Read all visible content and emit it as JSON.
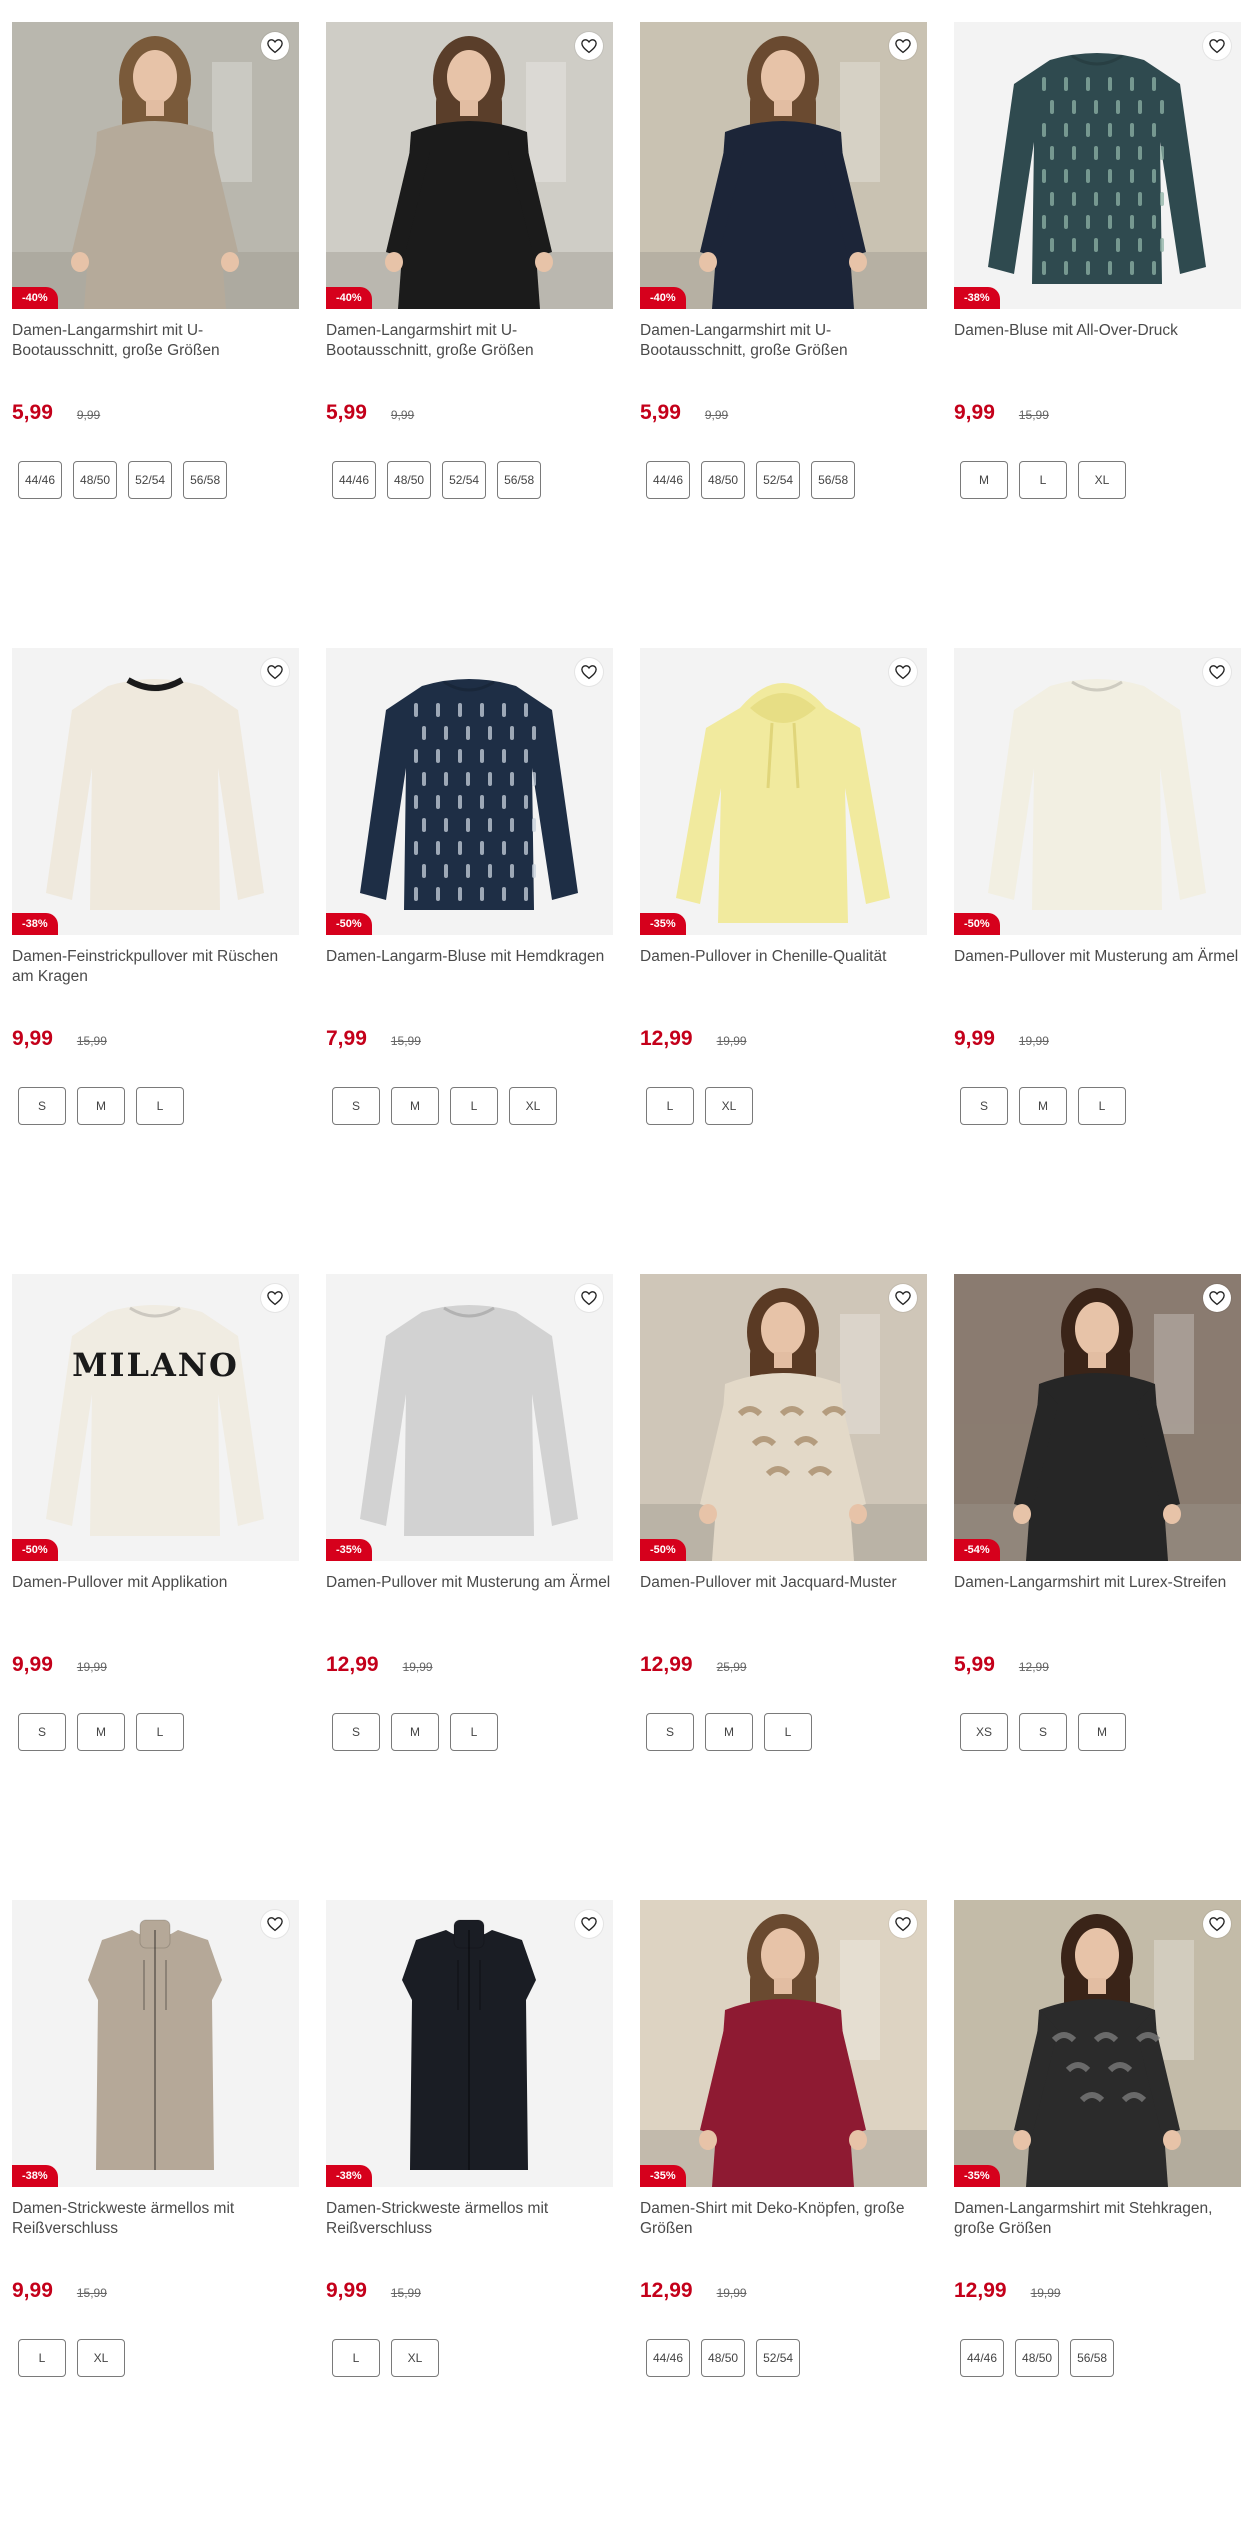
{
  "products": [
    {
      "title": "Damen-Langarmshirt mit U-Bootausschnitt, große Größen",
      "price": "5,99",
      "old_price": "9,99",
      "discount": "-40%",
      "sizes": [
        "44/46",
        "48/50",
        "52/54",
        "56/58"
      ]
    },
    {
      "title": "Damen-Langarmshirt mit U-Bootausschnitt, große Größen",
      "price": "5,99",
      "old_price": "9,99",
      "discount": "-40%",
      "sizes": [
        "44/46",
        "48/50",
        "52/54",
        "56/58"
      ]
    },
    {
      "title": "Damen-Langarmshirt mit U-Bootausschnitt, große Größen",
      "price": "5,99",
      "old_price": "9,99",
      "discount": "-40%",
      "sizes": [
        "44/46",
        "48/50",
        "52/54",
        "56/58"
      ]
    },
    {
      "title": "Damen-Bluse mit All-Over-Druck",
      "price": "9,99",
      "old_price": "15,99",
      "discount": "-38%",
      "sizes": [
        "M",
        "L",
        "XL"
      ]
    },
    {
      "title": "Damen-Feinstrickpullover mit Rüschen am Kragen",
      "price": "9,99",
      "old_price": "15,99",
      "discount": "-38%",
      "sizes": [
        "S",
        "M",
        "L"
      ]
    },
    {
      "title": "Damen-Langarm-Bluse mit Hemdkragen",
      "price": "7,99",
      "old_price": "15,99",
      "discount": "-50%",
      "sizes": [
        "S",
        "M",
        "L",
        "XL"
      ]
    },
    {
      "title": "Damen-Pullover in Chenille-Qualität",
      "price": "12,99",
      "old_price": "19,99",
      "discount": "-35%",
      "sizes": [
        "L",
        "XL"
      ]
    },
    {
      "title": "Damen-Pullover mit Musterung am Ärmel",
      "price": "9,99",
      "old_price": "19,99",
      "discount": "-50%",
      "sizes": [
        "S",
        "M",
        "L"
      ]
    },
    {
      "title": "Damen-Pullover mit Applikation",
      "price": "9,99",
      "old_price": "19,99",
      "discount": "-50%",
      "sizes": [
        "S",
        "M",
        "L"
      ],
      "print_text": "MILANO"
    },
    {
      "title": "Damen-Pullover mit Musterung am Ärmel",
      "price": "12,99",
      "old_price": "19,99",
      "discount": "-35%",
      "sizes": [
        "S",
        "M",
        "L"
      ]
    },
    {
      "title": "Damen-Pullover mit Jacquard-Muster",
      "price": "12,99",
      "old_price": "25,99",
      "discount": "-50%",
      "sizes": [
        "S",
        "M",
        "L"
      ]
    },
    {
      "title": "Damen-Langarmshirt mit Lurex-Streifen",
      "price": "5,99",
      "old_price": "12,99",
      "discount": "-54%",
      "sizes": [
        "XS",
        "S",
        "M"
      ]
    },
    {
      "title": "Damen-Strickweste ärmellos mit Reißverschluss",
      "price": "9,99",
      "old_price": "15,99",
      "discount": "-38%",
      "sizes": [
        "L",
        "XL"
      ]
    },
    {
      "title": "Damen-Strickweste ärmellos mit Reißverschluss",
      "price": "9,99",
      "old_price": "15,99",
      "discount": "-38%",
      "sizes": [
        "L",
        "XL"
      ]
    },
    {
      "title": "Damen-Shirt mit Deko-Knöpfen, große Größen",
      "price": "12,99",
      "old_price": "19,99",
      "discount": "-35%",
      "sizes": [
        "44/46",
        "48/50",
        "52/54"
      ]
    },
    {
      "title": "Damen-Langarmshirt mit Stehkragen, große Größen",
      "price": "12,99",
      "old_price": "19,99",
      "discount": "-35%",
      "sizes": [
        "44/46",
        "48/50",
        "56/58"
      ]
    }
  ],
  "images": [
    {
      "type": "model",
      "bg": "#b9b7ae",
      "garment": "#b5aa9a",
      "hair": "#7a5a3a",
      "name": "beige-shirt-photo"
    },
    {
      "type": "model",
      "bg": "#cfcdc6",
      "garment": "#1b1b1b",
      "hair": "#5a3e2a",
      "name": "black-shirt-photo"
    },
    {
      "type": "model",
      "bg": "#c9c2b2",
      "garment": "#1c2538",
      "hair": "#6a4a30",
      "name": "navy-shirt-photo"
    },
    {
      "type": "flat",
      "bg": "#f3f3f3",
      "garment": "#2f4a4f",
      "pattern": "#8fb3a5",
      "name": "printed-blouse-photo"
    },
    {
      "type": "flat",
      "bg": "#f3f3f3",
      "garment": "#efe9dd",
      "collar": "#1a1a1a",
      "name": "cream-sweater-photo"
    },
    {
      "type": "flat",
      "bg": "#f3f3f3",
      "garment": "#1e2e45",
      "pattern": "#c8d2dc",
      "name": "striped-blouse-photo"
    },
    {
      "type": "hoodie",
      "bg": "#f3f3f3",
      "garment": "#f1ea9e",
      "name": "yellow-hoodie-photo"
    },
    {
      "type": "flat",
      "bg": "#f3f3f3",
      "garment": "#f2efe2",
      "name": "ivory-sweater-photo"
    },
    {
      "type": "flat",
      "bg": "#f3f3f3",
      "garment": "#f0ece2",
      "print": "#1a1a1a",
      "name": "milano-sweater-photo"
    },
    {
      "type": "flat",
      "bg": "#f3f3f3",
      "garment": "#d2d2d2",
      "name": "grey-sweater-photo"
    },
    {
      "type": "model",
      "bg": "#cfc6b8",
      "garment": "#e3d9c8",
      "pattern": "#a88c6c",
      "hair": "#5a3a24",
      "name": "jacquard-sweater-photo"
    },
    {
      "type": "model",
      "bg": "#8a7c70",
      "garment": "#262626",
      "hair": "#3a2418",
      "name": "lurex-shirt-photo"
    },
    {
      "type": "vest",
      "bg": "#f3f3f3",
      "garment": "#b5a898",
      "name": "beige-vest-photo"
    },
    {
      "type": "vest",
      "bg": "#f3f3f3",
      "garment": "#1a1d24",
      "name": "black-vest-photo"
    },
    {
      "type": "model",
      "bg": "#ddd3c2",
      "garment": "#8e1a32",
      "hair": "#6a4a30",
      "name": "red-shirt-photo"
    },
    {
      "type": "model",
      "bg": "#c3bba9",
      "garment": "#2b2b2b",
      "pattern": "#7a7a7a",
      "hair": "#3a2418",
      "name": "patterned-shirt-photo"
    }
  ],
  "colors": {
    "accent": "#c4001a",
    "badge": "#d6001c"
  }
}
